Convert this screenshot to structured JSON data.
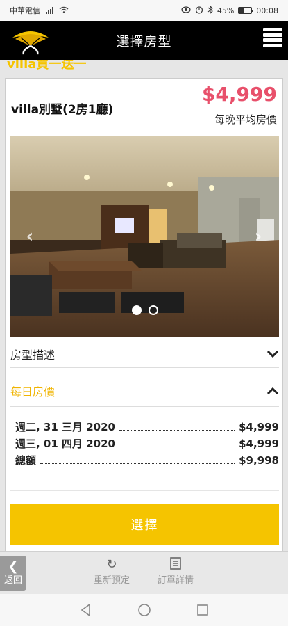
{
  "status_bar": {
    "carrier": "中華電信",
    "battery": "45%",
    "battery_level": 0.45,
    "time": "00:08"
  },
  "header": {
    "title": "選擇房型"
  },
  "promo": {
    "text": "villa買一送一"
  },
  "room": {
    "name": "villa別墅(2房1廳)",
    "price": "$4,999",
    "price_note": "每晚平均房價",
    "carousel": {
      "slides": 2,
      "active": 1
    }
  },
  "sections": {
    "description": "房型描述",
    "daily_price": "每日房價"
  },
  "daily_rates": [
    {
      "label": "週二, 31 三月 2020",
      "amount": "$4,999"
    },
    {
      "label": "週三, 01 四月 2020",
      "amount": "$4,999"
    }
  ],
  "total": {
    "label": "總額",
    "amount": "$9,998"
  },
  "select_button": "選擇",
  "bottom_bar": {
    "back": "返回",
    "rebook": "重新預定",
    "order_details": "訂單詳情"
  },
  "colors": {
    "accent": "#f5c400",
    "price": "#e8506b",
    "header": "#000000"
  }
}
